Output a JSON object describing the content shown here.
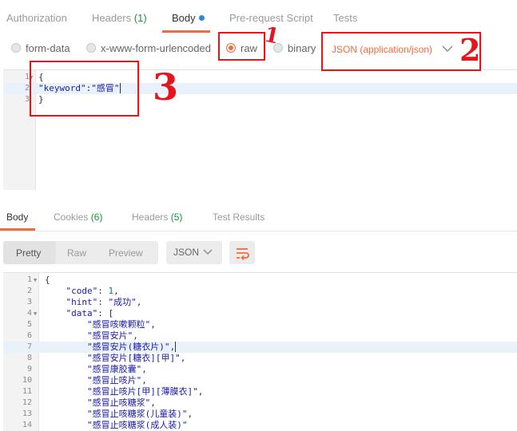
{
  "request_tabs": {
    "authorization": "Authorization",
    "headers_label": "Headers",
    "headers_count": "(1)",
    "body": "Body",
    "pre_request": "Pre-request Script",
    "tests": "Tests"
  },
  "body_options": {
    "form_data": "form-data",
    "urlencoded": "x-www-form-urlencoded",
    "raw": "raw",
    "binary": "binary",
    "selected": "raw",
    "content_type": "JSON (application/json)"
  },
  "request_editor": {
    "lines": [
      {
        "num": "1",
        "text": "{"
      },
      {
        "num": "2",
        "key": "\"keyword\"",
        "sep": ":",
        "value": "\"感冒\""
      },
      {
        "num": "3",
        "text": "}"
      }
    ]
  },
  "response_tabs": {
    "body": "Body",
    "cookies_label": "Cookies",
    "cookies_count": "(6)",
    "headers_label": "Headers",
    "headers_count": "(5)",
    "test_results": "Test Results"
  },
  "response_toolbar": {
    "pretty": "Pretty",
    "raw": "Raw",
    "preview": "Preview",
    "format": "JSON"
  },
  "response_lines": [
    {
      "num": "1",
      "indent": "",
      "text": "{"
    },
    {
      "num": "2",
      "indent": "    ",
      "key": "\"code\"",
      "sep": ": ",
      "value": "1",
      "tail": ","
    },
    {
      "num": "3",
      "indent": "    ",
      "key": "\"hint\"",
      "sep": ": ",
      "value": "\"成功\"",
      "tail": ","
    },
    {
      "num": "4",
      "indent": "    ",
      "key": "\"data\"",
      "sep": ": ",
      "value": "",
      "tail": "["
    },
    {
      "num": "5",
      "indent": "        ",
      "value": "\"感冒咳嗽颗粒\"",
      "tail": ","
    },
    {
      "num": "6",
      "indent": "        ",
      "value": "\"感冒安片\"",
      "tail": ","
    },
    {
      "num": "7",
      "indent": "        ",
      "value": "\"感冒安片(糖衣片)\"",
      "tail": ","
    },
    {
      "num": "8",
      "indent": "        ",
      "value": "\"感冒安片[糖衣][甲]\"",
      "tail": ","
    },
    {
      "num": "9",
      "indent": "        ",
      "value": "\"感冒康胶囊\"",
      "tail": ","
    },
    {
      "num": "10",
      "indent": "        ",
      "value": "\"感冒止咳片\"",
      "tail": ","
    },
    {
      "num": "11",
      "indent": "        ",
      "value": "\"感冒止咳片[甲][薄膜衣]\"",
      "tail": ","
    },
    {
      "num": "12",
      "indent": "        ",
      "value": "\"感冒止咳糖浆\"",
      "tail": ","
    },
    {
      "num": "13",
      "indent": "        ",
      "value": "\"感冒止咳糖浆(儿童装)\"",
      "tail": ","
    },
    {
      "num": "14",
      "indent": "        ",
      "value": "\"感冒止咳糖浆(成人装)\"",
      "tail": ""
    }
  ],
  "annotations": [
    "1",
    "2",
    "3"
  ],
  "colors": {
    "accent": "#f26b3a",
    "annotation": "#e8141c",
    "count": "#1f8f40"
  }
}
